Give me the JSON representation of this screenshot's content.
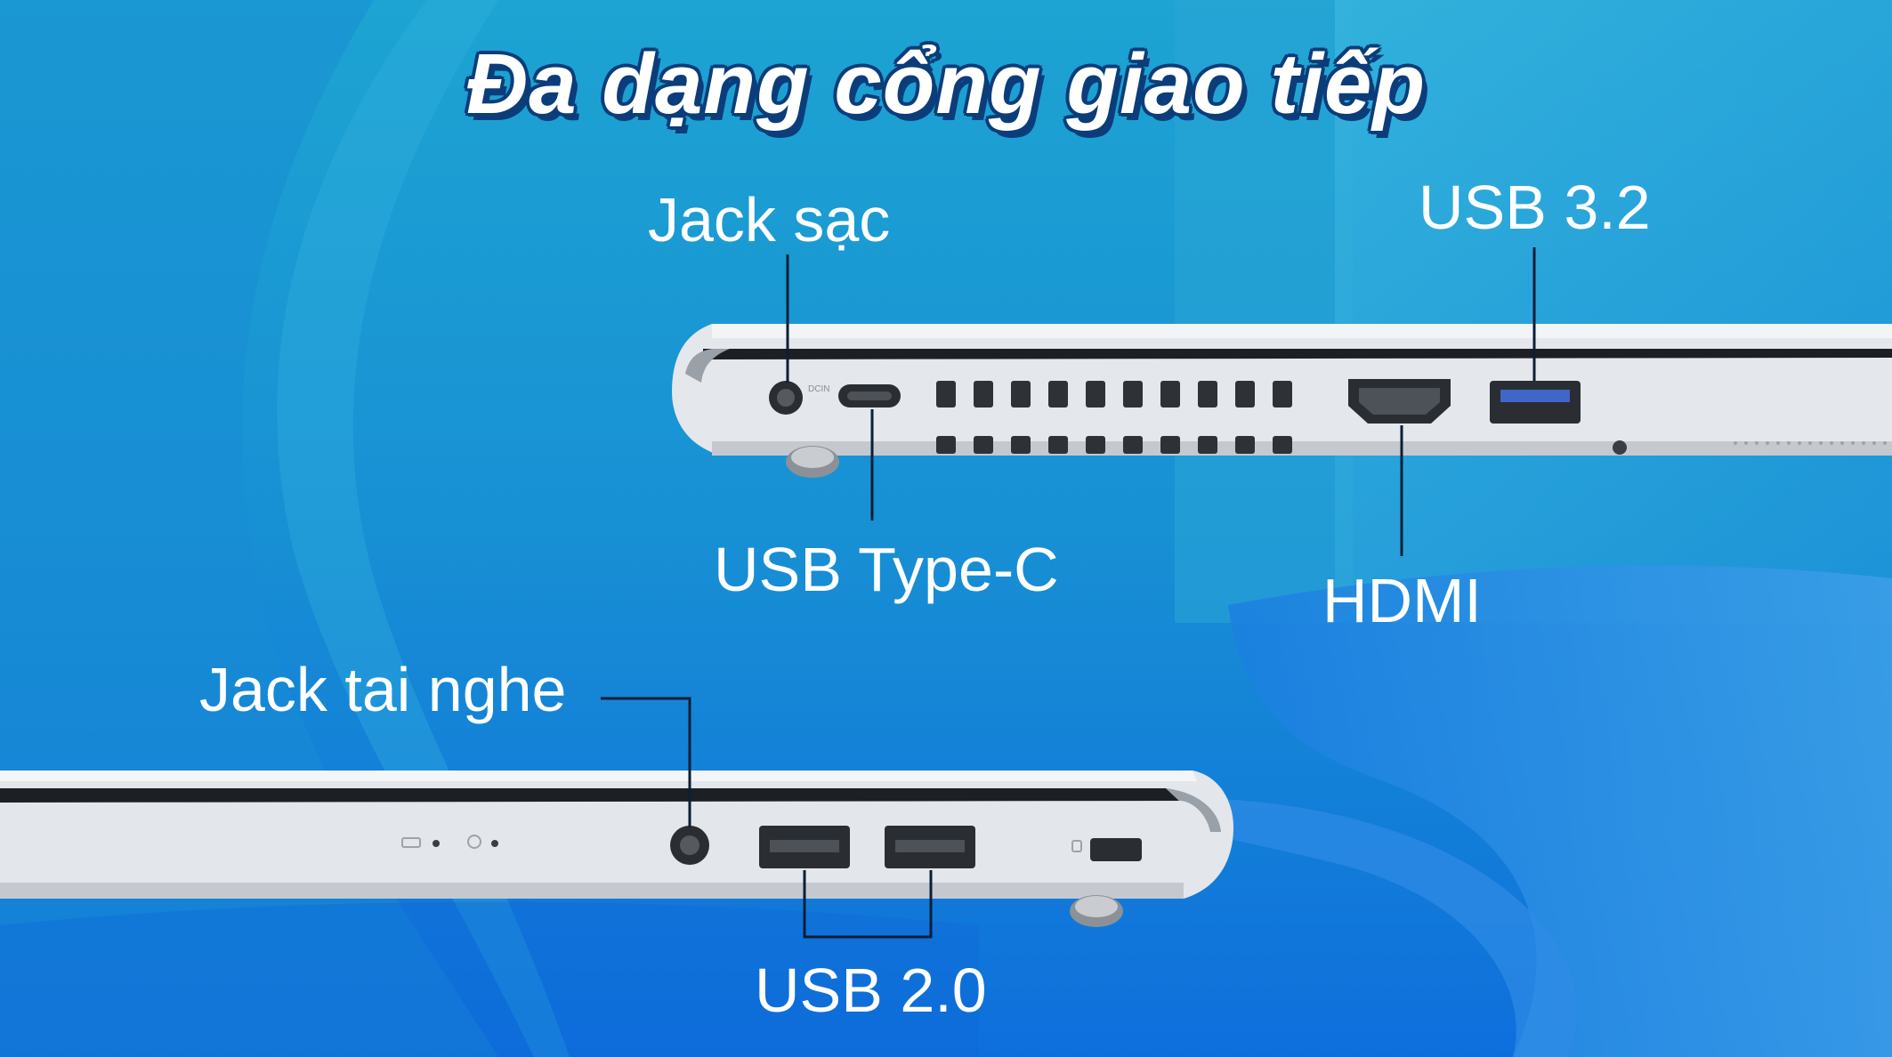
{
  "title": "Đa dạng cổng giao tiếp",
  "labels": {
    "jack_sac": "Jack sạc",
    "usb_32": "USB 3.2",
    "usb_type_c": "USB Type-C",
    "hdmi": "HDMI",
    "jack_tai_nghe": "Jack tai nghe",
    "usb_20": "USB 2.0"
  },
  "colors": {
    "background_top": "#1b9ad0",
    "background_bottom": "#0f74dc",
    "title_outline": "#0b3d7a",
    "label_text": "#ffffff",
    "laptop_body": "#e3e6ea"
  },
  "icons": [
    "laptop-right-side-image",
    "laptop-left-side-image"
  ]
}
